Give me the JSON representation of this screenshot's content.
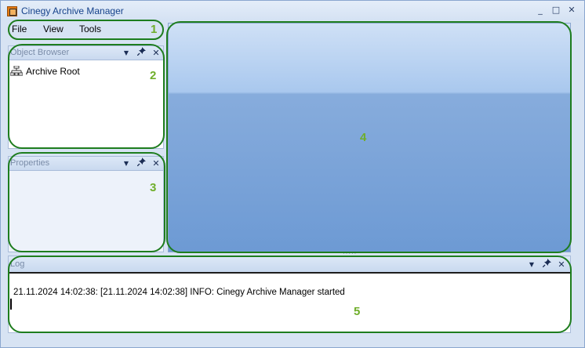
{
  "window": {
    "title": "Cinegy Archive Manager",
    "minimize_glyph": "_",
    "maximize_glyph": "□",
    "close_glyph": "✕"
  },
  "menu": {
    "items": [
      {
        "label": "File"
      },
      {
        "label": "View"
      },
      {
        "label": "Tools"
      }
    ]
  },
  "object_browser": {
    "title": "Object Browser",
    "root_label": "Archive Root",
    "icons": [
      "dropdown-arrow-icon",
      "pin-icon",
      "close-icon"
    ]
  },
  "properties": {
    "title": "Properties",
    "icons": [
      "dropdown-arrow-icon",
      "pin-icon",
      "close-icon"
    ]
  },
  "log": {
    "title": "Log",
    "line": "21.11.2024 14:02:38: [21.11.2024 14:02:38]  INFO: Cinegy Archive Manager started",
    "icons": [
      "dropdown-arrow-icon",
      "pin-icon",
      "close-icon"
    ]
  },
  "annotations": {
    "labels": [
      "1",
      "2",
      "3",
      "4",
      "5"
    ],
    "outline_color": "#1e7d1e",
    "label_color": "#6fae2a"
  },
  "glyphs": {
    "dropdown": "▼",
    "pin": "📌",
    "close": "✕"
  }
}
